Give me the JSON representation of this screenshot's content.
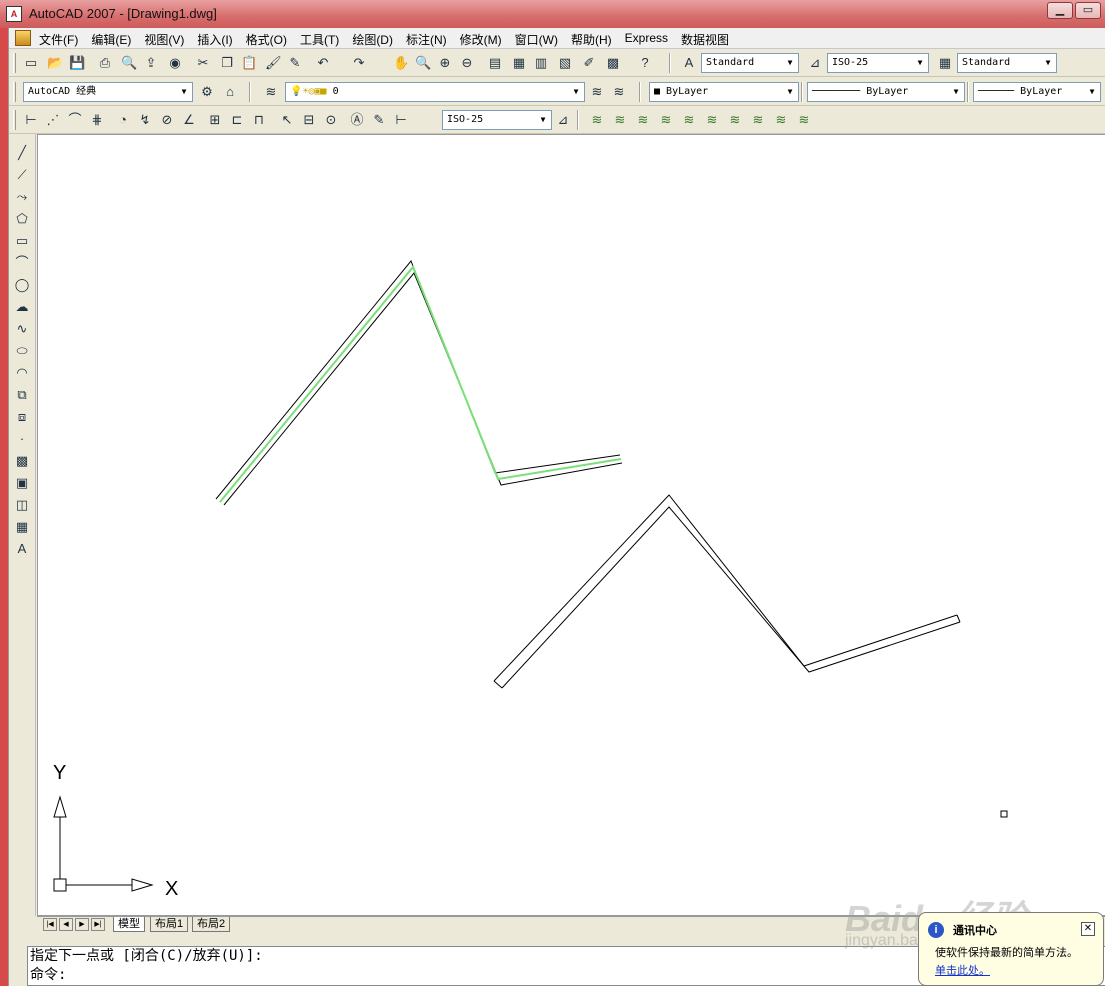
{
  "window": {
    "title": "AutoCAD 2007 - [Drawing1.dwg]",
    "minimize": "▁",
    "restore": "▭"
  },
  "menu": {
    "items": [
      "文件(F)",
      "编辑(E)",
      "视图(V)",
      "插入(I)",
      "格式(O)",
      "工具(T)",
      "绘图(D)",
      "标注(N)",
      "修改(M)",
      "窗口(W)",
      "帮助(H)",
      "Express",
      "数据视图"
    ]
  },
  "toolbar1": {
    "text_style": "Standard",
    "dim_style": "ISO-25",
    "table_style": "Standard",
    "icons": [
      "new-icon",
      "open-icon",
      "save-icon",
      "plot-icon",
      "plot-preview-icon",
      "publish-icon",
      "3d-dwf-icon",
      "cut-icon",
      "copy-icon",
      "paste-icon",
      "match-properties-icon",
      "block-editor-icon",
      "undo-icon",
      "redo-icon",
      "pan-icon",
      "zoom-realtime-icon",
      "zoom-window-icon",
      "zoom-previous-icon",
      "properties-icon",
      "design-center-icon",
      "tool-palettes-icon",
      "sheet-set-icon",
      "markup-icon",
      "quickcalc-icon",
      "help-icon"
    ]
  },
  "toolbar2": {
    "workspace": "AutoCAD 经典",
    "layer": "0",
    "color": "ByLayer",
    "linetype": "ByLayer",
    "lineweight": "ByLayer"
  },
  "toolbar3": {
    "dim_style": "ISO-25"
  },
  "draw_tools": [
    "line-icon",
    "construction-line-icon",
    "polyline-icon",
    "polygon-icon",
    "rectangle-icon",
    "arc-icon",
    "circle-icon",
    "revision-cloud-icon",
    "spline-icon",
    "ellipse-icon",
    "ellipse-arc-icon",
    "insert-block-icon",
    "make-block-icon",
    "point-icon",
    "hatch-icon",
    "gradient-icon",
    "region-icon",
    "table-icon",
    "multiline-text-icon"
  ],
  "ucs": {
    "x_label": "X",
    "y_label": "Y"
  },
  "layout_tabs": [
    "模型",
    "布局1",
    "布局2"
  ],
  "command": {
    "line1": "指定下一点或 [闭合(C)/放弃(U)]:",
    "line2": "命令:"
  },
  "notification": {
    "title": "通讯中心",
    "message": "使软件保持最新的简单方法。",
    "link": "单击此处。",
    "close": "✕"
  },
  "watermark": {
    "text": "Baidu 经验",
    "sub": "jingyan.baidu.com"
  }
}
